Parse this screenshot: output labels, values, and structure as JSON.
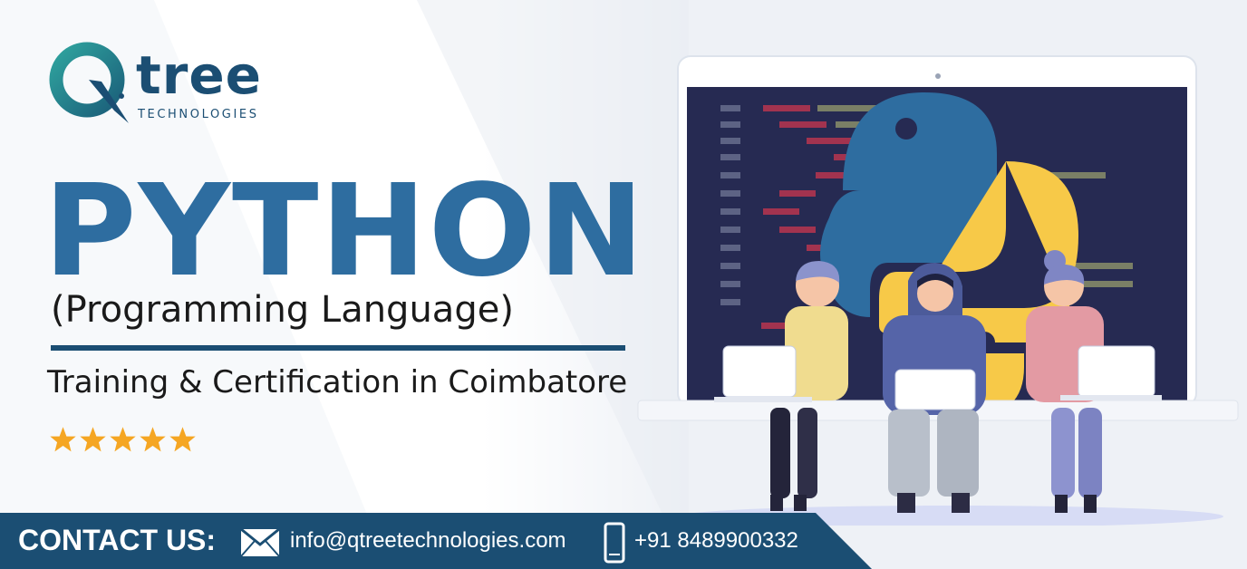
{
  "brand": {
    "name": "tree",
    "subtitle": "TECHNOLOGIES",
    "colors": {
      "primary": "#1b4e73",
      "accent": "#2a8c8c",
      "python_blue": "#2e6da0",
      "python_yellow": "#f7c948"
    }
  },
  "hero": {
    "title": "PYTHON",
    "subtitle": "(Programming Language)",
    "tagline": "Training & Certification in Coimbatore",
    "rating": 5
  },
  "contact": {
    "label": "CONTACT US:",
    "email": "info@qtreetechnologies.com",
    "phone": "+91 8489900332",
    "email_icon": "envelope-icon",
    "phone_icon": "smartphone-icon"
  },
  "illustration": {
    "icon": "python-logo-icon",
    "people": [
      "student-left",
      "student-center-hoodie",
      "student-right"
    ]
  }
}
